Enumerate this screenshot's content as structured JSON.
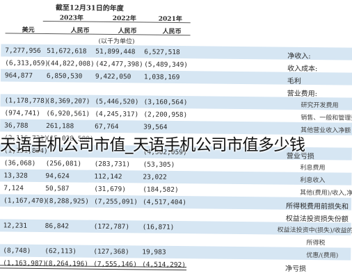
{
  "header": {
    "date": "截至12月31日的年度",
    "year_2023": "2023年",
    "year_2022": "2022年",
    "year_2021": "2021年",
    "currencies": [
      "美元",
      "人民币",
      "人民币",
      "人民币"
    ],
    "unit": "(以千为单位)"
  },
  "rows": [
    {
      "values": [
        "7,277,956",
        "51,672,618",
        "51,899,448",
        "6,527,518"
      ],
      "label": "净收入:",
      "style": "label"
    },
    {
      "values": [
        "(6,313,059)",
        "(44,822,008)",
        "(42,477,398)",
        "(5,489,349)"
      ],
      "label": "收入成本:",
      "style": "label"
    },
    {
      "values": [
        "964,877",
        "6,850,530",
        "9,422,050",
        "1,038,169"
      ],
      "label": "毛利",
      "style": "label"
    },
    {
      "values": [
        "",
        "",
        "",
        ""
      ],
      "label": "营业费用:",
      "style": "label"
    },
    {
      "values": [
        "(1,178,778)",
        "(8,369,207)",
        "(5,446,520)",
        "(3,160,564)"
      ],
      "label": "研究开发费用",
      "style": "indent"
    },
    {
      "values": [
        "(974,741)",
        "(6,920,561)",
        "(4,245,317)",
        "(2,200,958)"
      ],
      "label": "销售、一般和管理费用",
      "style": "indent"
    },
    {
      "values": [
        "36,788",
        "261,188",
        "67,764",
        "39,564"
      ],
      "label": "其他营业收入净额",
      "style": "indent"
    },
    {
      "values": [
        "(2,116,731)",
        "(15,028,580)",
        "",
        ""
      ],
      "label": "",
      "style": "plain"
    },
    {
      "values": [
        "(1,151,854)",
        "",
        "",
        "(4,362,059)"
      ],
      "label": "营业亏损",
      "style": "label"
    },
    {
      "values": [
        "(36,068)",
        "(256,081)",
        "(283,731)",
        "(53,305)"
      ],
      "label": "利息费用",
      "style": "indent"
    },
    {
      "values": [
        "13,328",
        "94,624",
        "112,142",
        "23,022"
      ],
      "label": "利息收入",
      "style": "indent"
    },
    {
      "values": [
        "7,124",
        "50,587",
        "(31,679)",
        "(184,582)"
      ],
      "label": "其他(费用)/收入,净额",
      "style": "indent"
    },
    {
      "values": [
        "(1,167,470)",
        "(8,288,925)",
        "(7,255,091)",
        "(4,517,404)"
      ],
      "label": "所得税费用前损失和",
      "style": "label"
    },
    {
      "values": [
        "",
        "",
        "",
        ""
      ],
      "label": "权益法投资损失份额",
      "style": "label"
    },
    {
      "values": [
        "12,231",
        "86,842",
        "(172,787)",
        "(16,871)"
      ],
      "label": "权益法投资中(损失)/收益的份额",
      "style": "indent2"
    },
    {
      "values": [
        "",
        "",
        "",
        ""
      ],
      "label": "所得税",
      "style": "sub"
    },
    {
      "values": [
        "(8,748)",
        "(62,113)",
        "(127,368)",
        "19,983"
      ],
      "label": "优惠/(费用)",
      "style": "sub"
    },
    {
      "values": [
        "(1,163,987)",
        "(8,264,196)",
        "(7,555,146)",
        "(4,514,292)"
      ],
      "label": "净亏损",
      "style": "label"
    }
  ],
  "watermark": "天语手机公司市值_天语手机公司市值多少钱"
}
